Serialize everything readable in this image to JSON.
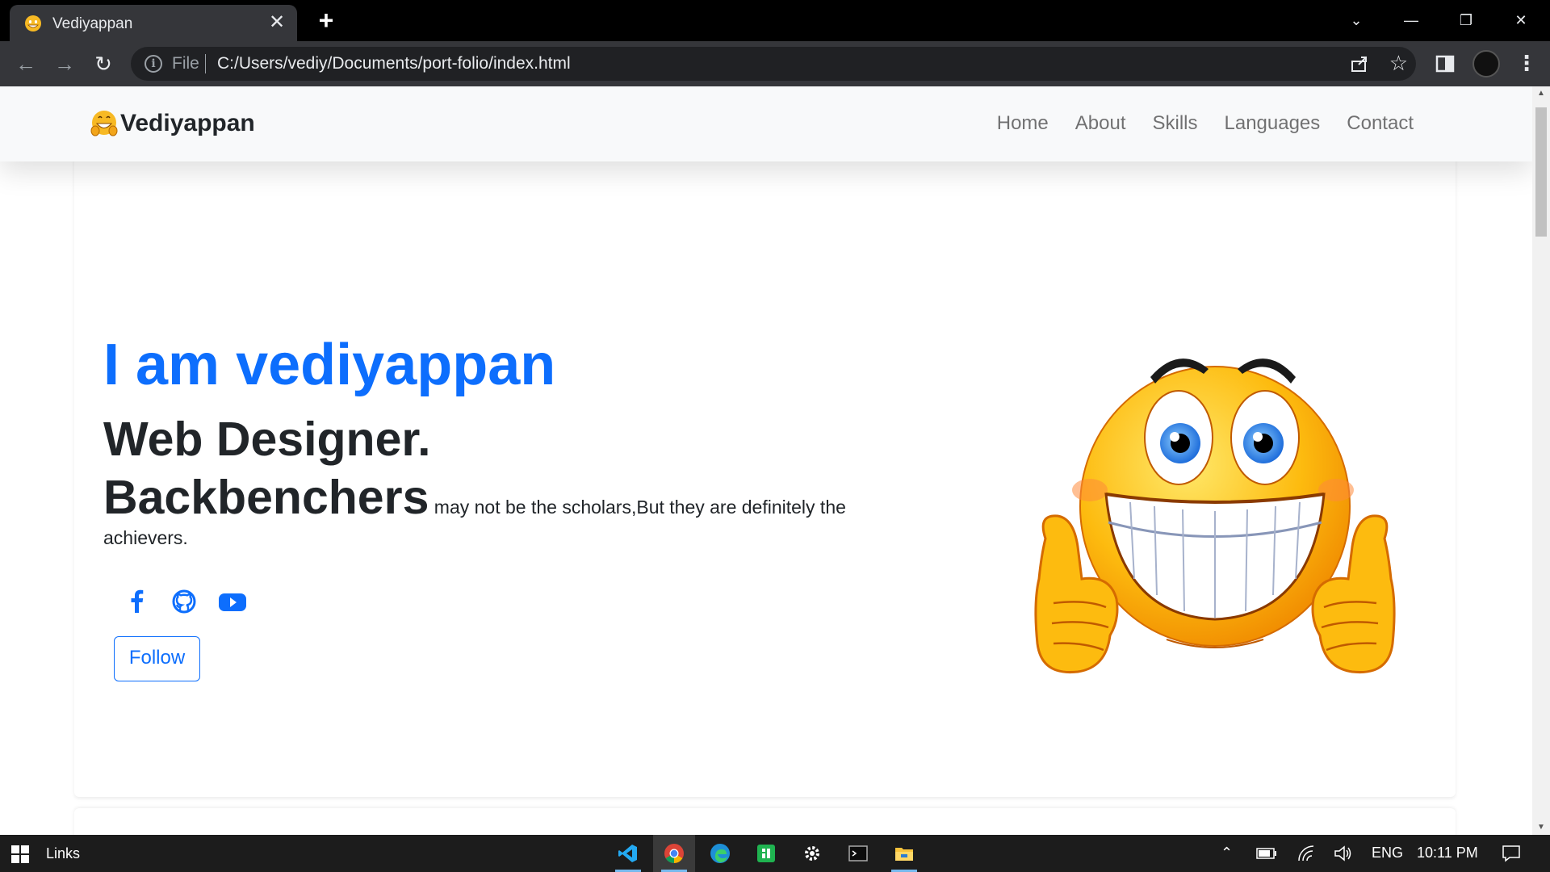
{
  "browser": {
    "tab_title": "Vediyappan",
    "tab_close": "✕",
    "new_tab": "+",
    "window_controls": {
      "tabsearch": "⌄",
      "minimize": "—",
      "restore": "❐",
      "close": "✕"
    },
    "omnibox": {
      "scheme": "File",
      "url": "C:/Users/vediy/Documents/port-folio/index.html"
    }
  },
  "page": {
    "brand": "Vediyappan",
    "nav": [
      "Home",
      "About",
      "Skills",
      "Languages",
      "Contact"
    ],
    "hero": {
      "title": "I am vediyappan",
      "role": "Web Designer.",
      "quote_bold": "Backbenchers",
      "quote_rest": " may not be the scholars,But they are definitely the achievers.",
      "follow_label": "Follow"
    },
    "socials": [
      "facebook-icon",
      "github-icon",
      "youtube-icon"
    ]
  },
  "colors": {
    "primary": "#0d6efd",
    "text": "#212529",
    "navbar_bg": "#f8f9fa"
  },
  "taskbar": {
    "label": "Links",
    "apps": [
      "vscode-icon",
      "chrome-icon",
      "edge-icon",
      "app-icon",
      "settings-icon",
      "terminal-icon",
      "file-explorer-icon"
    ],
    "tray": {
      "language": "ENG",
      "time": "10:11 PM"
    }
  }
}
